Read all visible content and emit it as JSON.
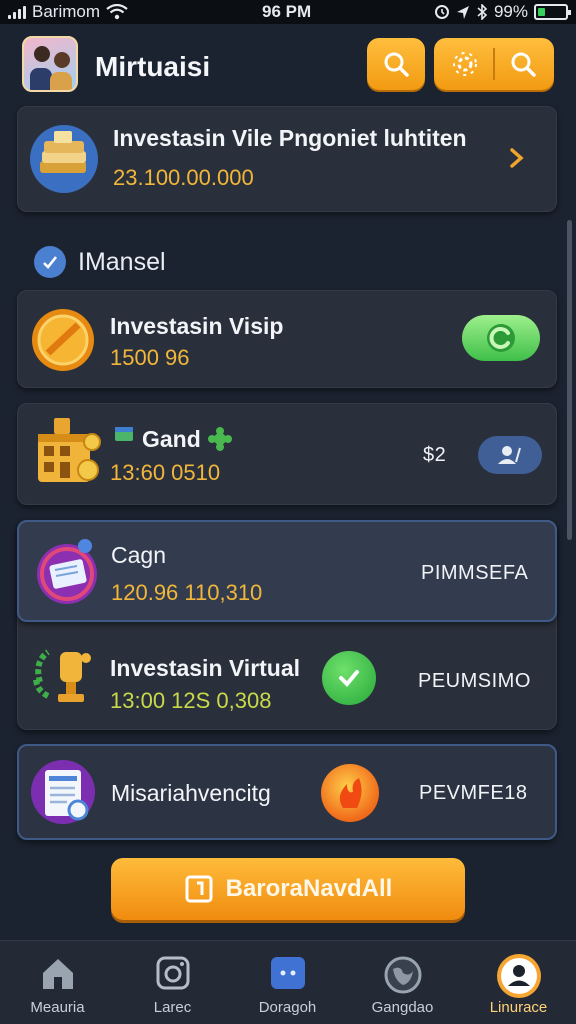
{
  "status_bar": {
    "carrier": "Barimom",
    "time": "96 PM",
    "battery": "99%",
    "battery_level": 0.25
  },
  "header": {
    "title": "Mirtuaisi",
    "icons": [
      "search-icon",
      "gear-icon",
      "search-icon"
    ]
  },
  "top_card": {
    "title": "Investasin Vile Pngoniet luhtiten",
    "value": "23.100.00.000"
  },
  "section": {
    "label": "IMansel"
  },
  "cards": [
    {
      "title": "Investasin Visip",
      "value": "1500 96"
    },
    {
      "title": "Gand",
      "value": "13:60 0510",
      "tag": "$2"
    },
    {
      "title": "Cagn",
      "value": "120.96 110,310",
      "tag": "PIMMSEFA"
    },
    {
      "title": "Investasin Virtual",
      "value": "13:00 12S 0,308",
      "tag": "PEUMSIMO"
    },
    {
      "title": "Misariahvencitg",
      "tag": "PEVMFE18"
    }
  ],
  "cta": {
    "label": "BaroraNavdAll"
  },
  "nav": [
    {
      "label": "Meauria",
      "icon": "home-icon"
    },
    {
      "label": "Larec",
      "icon": "camera-icon"
    },
    {
      "label": "Doragoh",
      "icon": "chat-icon"
    },
    {
      "label": "Gangdao",
      "icon": "globe-icon"
    },
    {
      "label": "Linurace",
      "icon": "profile-icon"
    }
  ],
  "colors": {
    "background": "#1c2330",
    "card": "#2a303b",
    "accent_orange": "#f5a623",
    "value_gold": "#f2b73a",
    "selected_border": "#3f5a86"
  }
}
